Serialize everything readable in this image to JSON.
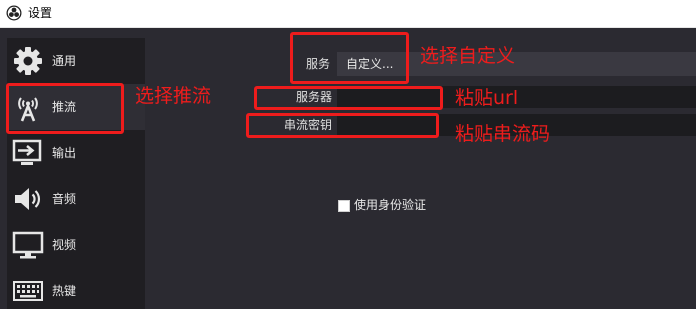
{
  "window": {
    "title": "设置",
    "app_icon": "obs-logo-icon"
  },
  "sidebar": {
    "items": [
      {
        "label": "通用",
        "icon": "gear-icon"
      },
      {
        "label": "推流",
        "icon": "broadcast-icon",
        "selected": true
      },
      {
        "label": "输出",
        "icon": "output-icon"
      },
      {
        "label": "音频",
        "icon": "speaker-icon"
      },
      {
        "label": "视频",
        "icon": "monitor-icon"
      },
      {
        "label": "热键",
        "icon": "keyboard-icon"
      }
    ]
  },
  "stream": {
    "service_label": "服务",
    "service_value": "自定义...",
    "server_label": "服务器",
    "server_value": "",
    "key_label": "串流密钥",
    "key_value": "",
    "auth_label": "使用身份验证",
    "auth_checked": false
  },
  "annotations": {
    "choose_custom": "选择自定义",
    "choose_stream": "选择推流",
    "paste_url": "粘贴url",
    "paste_key": "粘贴串流码",
    "color": "#ee1c1c"
  }
}
